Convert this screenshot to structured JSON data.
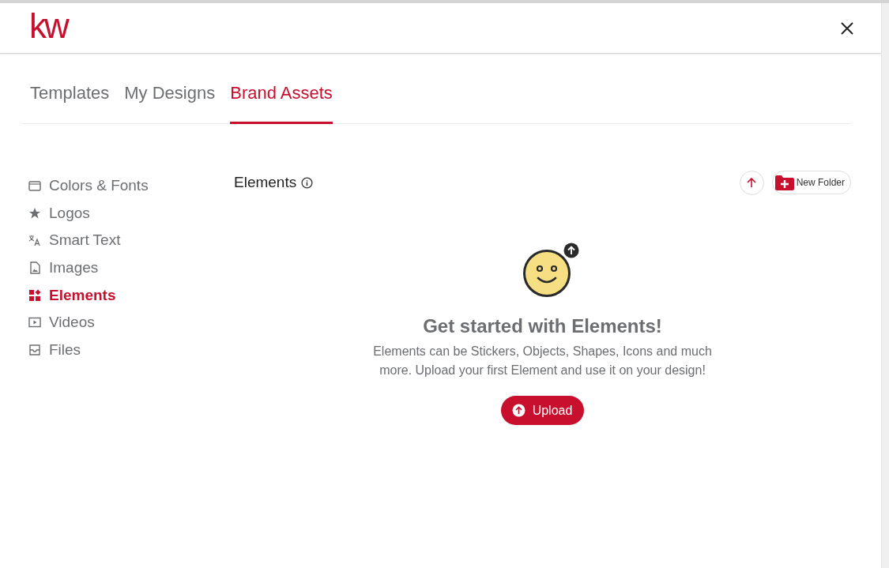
{
  "header": {
    "logo": "kw"
  },
  "tabs": [
    {
      "label": "Templates",
      "selected": false
    },
    {
      "label": "My Designs",
      "selected": false
    },
    {
      "label": "Brand Assets",
      "selected": true
    }
  ],
  "sidebar": {
    "items": [
      {
        "kind": "palette",
        "label": "Colors & Fonts",
        "selected": false
      },
      {
        "kind": "star",
        "label": "Logos",
        "selected": false
      },
      {
        "kind": "translate",
        "label": "Smart Text",
        "selected": false
      },
      {
        "kind": "image",
        "label": "Images",
        "selected": false
      },
      {
        "kind": "widgets",
        "label": "Elements",
        "selected": true
      },
      {
        "kind": "video",
        "label": "Videos",
        "selected": false
      },
      {
        "kind": "inbox",
        "label": "Files",
        "selected": false
      }
    ]
  },
  "content": {
    "title": "Elements",
    "new_folder": "New Folder",
    "empty_state": {
      "heading": "Get started with Elements!",
      "text": "Elements can be Stickers, Objects, Shapes, Icons and much more. Upload your first Element and use it on your design!",
      "button": "Upload"
    }
  }
}
